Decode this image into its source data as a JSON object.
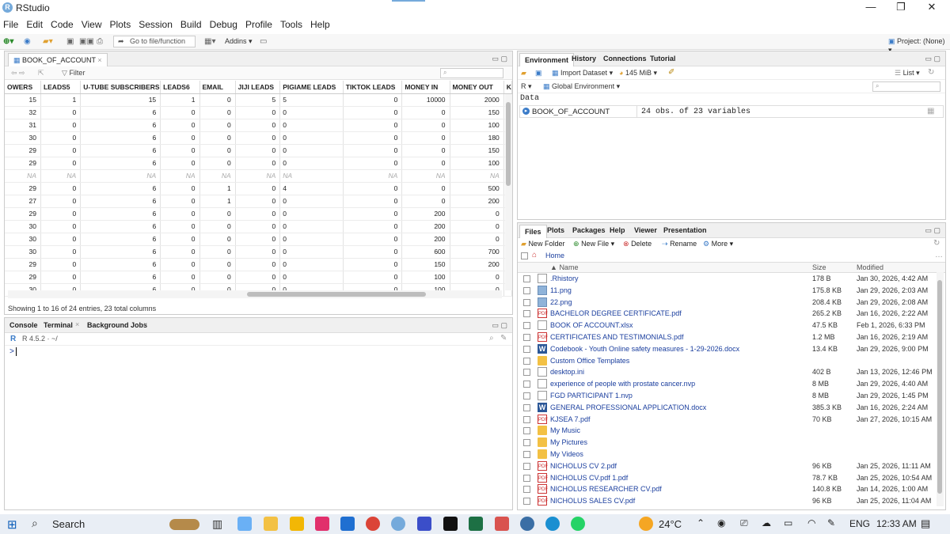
{
  "window": {
    "title": "RStudio"
  },
  "menu": [
    "File",
    "Edit",
    "Code",
    "View",
    "Plots",
    "Session",
    "Build",
    "Debug",
    "Profile",
    "Tools",
    "Help"
  ],
  "toolbar": {
    "goto_placeholder": "Go to file/function",
    "addins": "Addins",
    "project": "Project: (None)"
  },
  "data_viewer": {
    "tab_label": "BOOK_OF_ACCOUNT",
    "filter_label": "Filter",
    "columns": [
      "OWERS",
      "LEADS5",
      "U-TUBE SUBSCRIBERS",
      "LEADS6",
      "EMAIL",
      "JIJI LEADS",
      "PIGIAME LEADS",
      "TIKTOK LEADS",
      "MONEY IN",
      "MONEY OUT",
      "K"
    ],
    "rows": [
      [
        "15",
        "1",
        "15",
        "1",
        "0",
        "5",
        "5",
        "0",
        "10000",
        "2000"
      ],
      [
        "32",
        "0",
        "6",
        "0",
        "0",
        "0",
        "0",
        "0",
        "0",
        "150"
      ],
      [
        "31",
        "0",
        "6",
        "0",
        "0",
        "0",
        "0",
        "0",
        "0",
        "100"
      ],
      [
        "30",
        "0",
        "6",
        "0",
        "0",
        "0",
        "0",
        "0",
        "0",
        "180"
      ],
      [
        "29",
        "0",
        "6",
        "0",
        "0",
        "0",
        "0",
        "0",
        "0",
        "150"
      ],
      [
        "29",
        "0",
        "6",
        "0",
        "0",
        "0",
        "0",
        "0",
        "0",
        "100"
      ],
      [
        "NA",
        "NA",
        "NA",
        "NA",
        "NA",
        "NA",
        "NA",
        "NA",
        "NA",
        "NA"
      ],
      [
        "29",
        "0",
        "6",
        "0",
        "1",
        "0",
        "4",
        "0",
        "0",
        "500"
      ],
      [
        "27",
        "0",
        "6",
        "0",
        "1",
        "0",
        "0",
        "0",
        "0",
        "200"
      ],
      [
        "29",
        "0",
        "6",
        "0",
        "0",
        "0",
        "0",
        "0",
        "200",
        "0"
      ],
      [
        "30",
        "0",
        "6",
        "0",
        "0",
        "0",
        "0",
        "0",
        "200",
        "0"
      ],
      [
        "30",
        "0",
        "6",
        "0",
        "0",
        "0",
        "0",
        "0",
        "200",
        "0"
      ],
      [
        "30",
        "0",
        "6",
        "0",
        "0",
        "0",
        "0",
        "0",
        "600",
        "700"
      ],
      [
        "29",
        "0",
        "6",
        "0",
        "0",
        "0",
        "0",
        "0",
        "150",
        "200"
      ],
      [
        "29",
        "0",
        "6",
        "0",
        "0",
        "0",
        "0",
        "0",
        "100",
        "0"
      ],
      [
        "30",
        "0",
        "6",
        "0",
        "0",
        "0",
        "0",
        "0",
        "100",
        "0"
      ]
    ],
    "status": "Showing 1 to 16 of 24 entries, 23 total columns"
  },
  "console": {
    "tabs": [
      "Console",
      "Terminal",
      "Background Jobs"
    ],
    "version": "R 4.5.2 · ~/",
    "prompt": ">"
  },
  "environment": {
    "tabs": [
      "Environment",
      "History",
      "Connections",
      "Tutorial"
    ],
    "import_label": "Import Dataset",
    "memory": "145 MiB",
    "list_label": "List",
    "lang": "R",
    "scope": "Global Environment",
    "section": "Data",
    "object_name": "BOOK_OF_ACCOUNT",
    "object_desc": "24 obs. of 23 variables"
  },
  "files": {
    "tabs": [
      "Files",
      "Plots",
      "Packages",
      "Help",
      "Viewer",
      "Presentation"
    ],
    "actions": [
      "New Folder",
      "New File",
      "Delete",
      "Rename",
      "More"
    ],
    "breadcrumb": "Home",
    "headers": [
      "Name",
      "Size",
      "Modified"
    ],
    "items": [
      {
        "name": ".Rhistory",
        "size": "178 B",
        "modified": "Jan 30, 2026, 4:42 AM",
        "icon": "gen"
      },
      {
        "name": "11.png",
        "size": "175.8 KB",
        "modified": "Jan 29, 2026, 2:03 AM",
        "icon": "img"
      },
      {
        "name": "22.png",
        "size": "208.4 KB",
        "modified": "Jan 29, 2026, 2:08 AM",
        "icon": "img"
      },
      {
        "name": "BACHELOR DEGREE CERTIFICATE.pdf",
        "size": "265.2 KB",
        "modified": "Jan 16, 2026, 2:22 AM",
        "icon": "pdf"
      },
      {
        "name": "BOOK OF ACCOUNT.xlsx",
        "size": "47.5 KB",
        "modified": "Feb 1, 2026, 6:33 PM",
        "icon": "gen"
      },
      {
        "name": "CERTIFICATES AND TESTIMONIALS.pdf",
        "size": "1.2 MB",
        "modified": "Jan 16, 2026, 2:19 AM",
        "icon": "pdf"
      },
      {
        "name": "Codebook - Youth Online safety measures - 1-29-2026.docx",
        "size": "13.4 KB",
        "modified": "Jan 29, 2026, 9:00 PM",
        "icon": "doc"
      },
      {
        "name": "Custom Office Templates",
        "size": "",
        "modified": "",
        "icon": "folder"
      },
      {
        "name": "desktop.ini",
        "size": "402 B",
        "modified": "Jan 13, 2026, 12:46 PM",
        "icon": "gen"
      },
      {
        "name": "experience of people with prostate cancer.nvp",
        "size": "8 MB",
        "modified": "Jan 29, 2026, 4:40 AM",
        "icon": "gen"
      },
      {
        "name": "FGD PARTICIPANT 1.nvp",
        "size": "8 MB",
        "modified": "Jan 29, 2026, 1:45 PM",
        "icon": "gen"
      },
      {
        "name": "GENERAL PROFESSIONAL APPLICATION.docx",
        "size": "385.3 KB",
        "modified": "Jan 16, 2026, 2:24 AM",
        "icon": "doc"
      },
      {
        "name": "KJSEA 7.pdf",
        "size": "70 KB",
        "modified": "Jan 27, 2026, 10:15 AM",
        "icon": "pdf"
      },
      {
        "name": "My Music",
        "size": "",
        "modified": "",
        "icon": "folder"
      },
      {
        "name": "My Pictures",
        "size": "",
        "modified": "",
        "icon": "folder"
      },
      {
        "name": "My Videos",
        "size": "",
        "modified": "",
        "icon": "folder"
      },
      {
        "name": "NICHOLUS CV 2.pdf",
        "size": "96 KB",
        "modified": "Jan 25, 2026, 11:11 AM",
        "icon": "pdf"
      },
      {
        "name": "NICHOLUS CV.pdf 1.pdf",
        "size": "78.7 KB",
        "modified": "Jan 25, 2026, 10:54 AM",
        "icon": "pdf"
      },
      {
        "name": "NICHOLUS RESEARCHER CV.pdf",
        "size": "140.8 KB",
        "modified": "Jan 14, 2026, 1:00 AM",
        "icon": "pdf"
      },
      {
        "name": "NICHOLUS SALES CV.pdf",
        "size": "96 KB",
        "modified": "Jan 25, 2026, 11:04 AM",
        "icon": "pdf"
      }
    ]
  },
  "taskbar": {
    "search": "Search",
    "weather": "24°C",
    "lang": "ENG",
    "time": "12:33 AM"
  }
}
